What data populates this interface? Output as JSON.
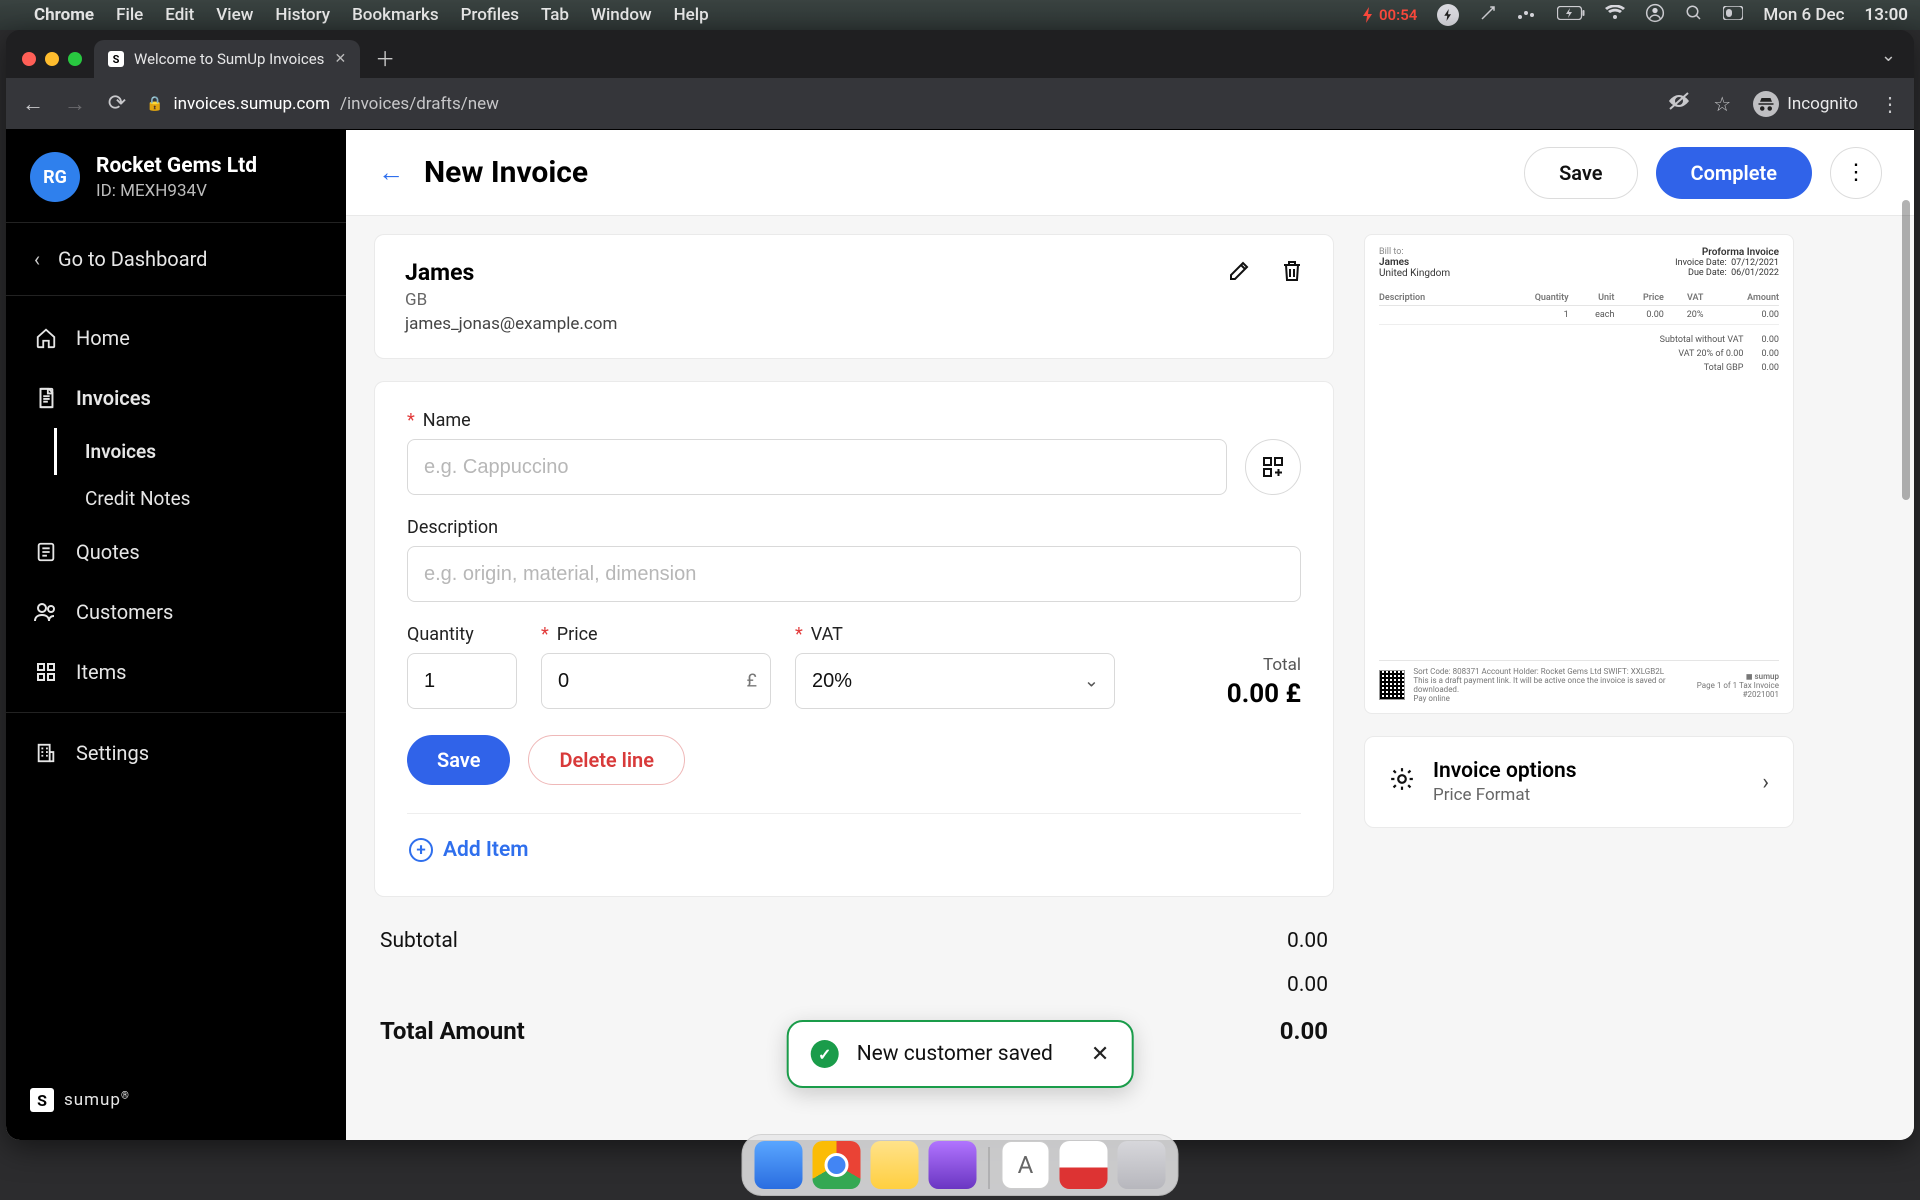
{
  "mac_menu": {
    "app": "Chrome",
    "items": [
      "File",
      "Edit",
      "View",
      "History",
      "Bookmarks",
      "Profiles",
      "Tab",
      "Window",
      "Help"
    ],
    "battery_time": "00:54",
    "date": "Mon 6 Dec",
    "time": "13:00"
  },
  "browser": {
    "tab_title": "Welcome to SumUp Invoices",
    "url_host": "invoices.sumup.com",
    "url_path": "/invoices/drafts/new",
    "incognito_label": "Incognito"
  },
  "sidebar": {
    "org_initials": "RG",
    "org_name": "Rocket Gems Ltd",
    "org_id_label": "ID: MEXH934V",
    "go_dashboard": "Go to Dashboard",
    "items": [
      {
        "label": "Home",
        "icon": "home"
      },
      {
        "label": "Invoices",
        "icon": "invoice",
        "active": true,
        "sub": [
          {
            "label": "Invoices",
            "active": true
          },
          {
            "label": "Credit Notes"
          }
        ]
      },
      {
        "label": "Quotes",
        "icon": "quote"
      },
      {
        "label": "Customers",
        "icon": "customers"
      },
      {
        "label": "Items",
        "icon": "items"
      }
    ],
    "settings_label": "Settings",
    "brand": "sumup"
  },
  "header": {
    "title": "New Invoice",
    "save": "Save",
    "complete": "Complete"
  },
  "customer": {
    "name": "James",
    "country_code": "GB",
    "email": "james_jonas@example.com"
  },
  "item_form": {
    "name_label": "Name",
    "name_placeholder": "e.g. Cappuccino",
    "description_label": "Description",
    "description_placeholder": "e.g. origin, material, dimension",
    "quantity_label": "Quantity",
    "quantity_value": "1",
    "price_label": "Price",
    "price_value": "0",
    "price_suffix": "£",
    "vat_label": "VAT",
    "vat_value": "20%",
    "total_label": "Total",
    "total_value": "0.00 £",
    "save_btn": "Save",
    "delete_btn": "Delete line",
    "add_item": "Add Item"
  },
  "summary": {
    "subtotal_label": "Subtotal",
    "subtotal_value": "0.00",
    "vat_value": "0.00",
    "total_label": "Total Amount",
    "total_value": "0.00"
  },
  "preview": {
    "bill_to_label": "Bill to:",
    "bill_to_name": "James",
    "bill_to_country": "United Kingdom",
    "type_label": "Proforma Invoice",
    "invoice_date_label": "Invoice Date:",
    "invoice_date": "07/12/2021",
    "due_date_label": "Due Date:",
    "due_date": "06/01/2022",
    "col_desc": "Description",
    "col_qty": "Quantity",
    "col_unit": "Unit",
    "col_price": "Price",
    "col_vat": "VAT",
    "col_amount": "Amount",
    "row_qty": "1",
    "row_unit": "each",
    "row_price": "0.00",
    "row_vat": "20%",
    "row_amount": "0.00",
    "sub_subtotal_label": "Subtotal without VAT",
    "sub_subtotal_value": "0.00",
    "sub_vat_label": "VAT 20% of 0.00",
    "sub_vat_value": "0.00",
    "sub_total_label": "Total GBP",
    "sub_total_value": "0.00",
    "footer_left_1": "Pay online",
    "footer_center": "Sort Code: 808371   Account Holder: Rocket Gems Ltd   SWIFT: XXLGB2L",
    "footer_center_2": "This is a draft payment link. It will be active once the invoice is saved or downloaded.",
    "footer_right": "Page 1 of 1   Tax Invoice  #2021001",
    "footer_brand": "sumup"
  },
  "options": {
    "title": "Invoice options",
    "sub": "Price Format"
  },
  "toast": {
    "message": "New customer saved"
  }
}
